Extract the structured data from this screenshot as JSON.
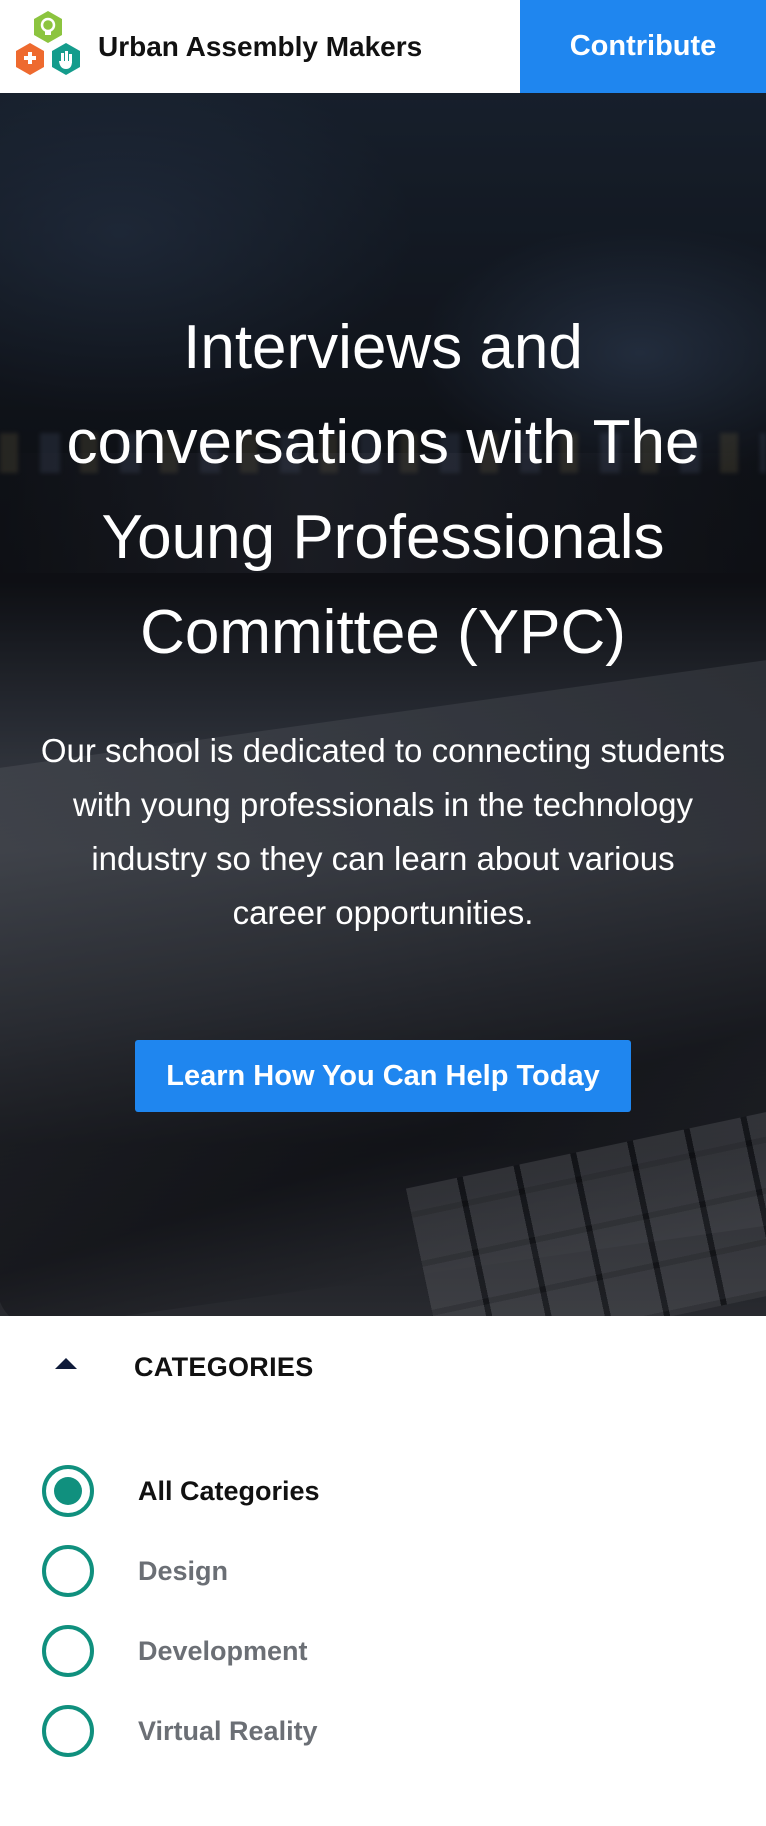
{
  "header": {
    "brand_name": "Urban Assembly Makers",
    "logo_icon": "hexagon-logo-icon",
    "contribute_label": "Contribute",
    "accent_color": "#1f86ef"
  },
  "hero": {
    "title": "Interviews and conversations with The Young Professionals Committee (YPC)",
    "description": "Our school is dedicated to connecting students with young professionals in the technology industry so they can learn about various career opportunities.",
    "cta_label": "Learn How You Can Help Today"
  },
  "categories": {
    "title": "CATEGORIES",
    "toggle_icon": "caret-up-icon",
    "accent_color": "#10907e",
    "items": [
      {
        "label": "All Categories",
        "selected": true
      },
      {
        "label": "Design",
        "selected": false
      },
      {
        "label": "Development",
        "selected": false
      },
      {
        "label": "Virtual Reality",
        "selected": false
      }
    ]
  }
}
